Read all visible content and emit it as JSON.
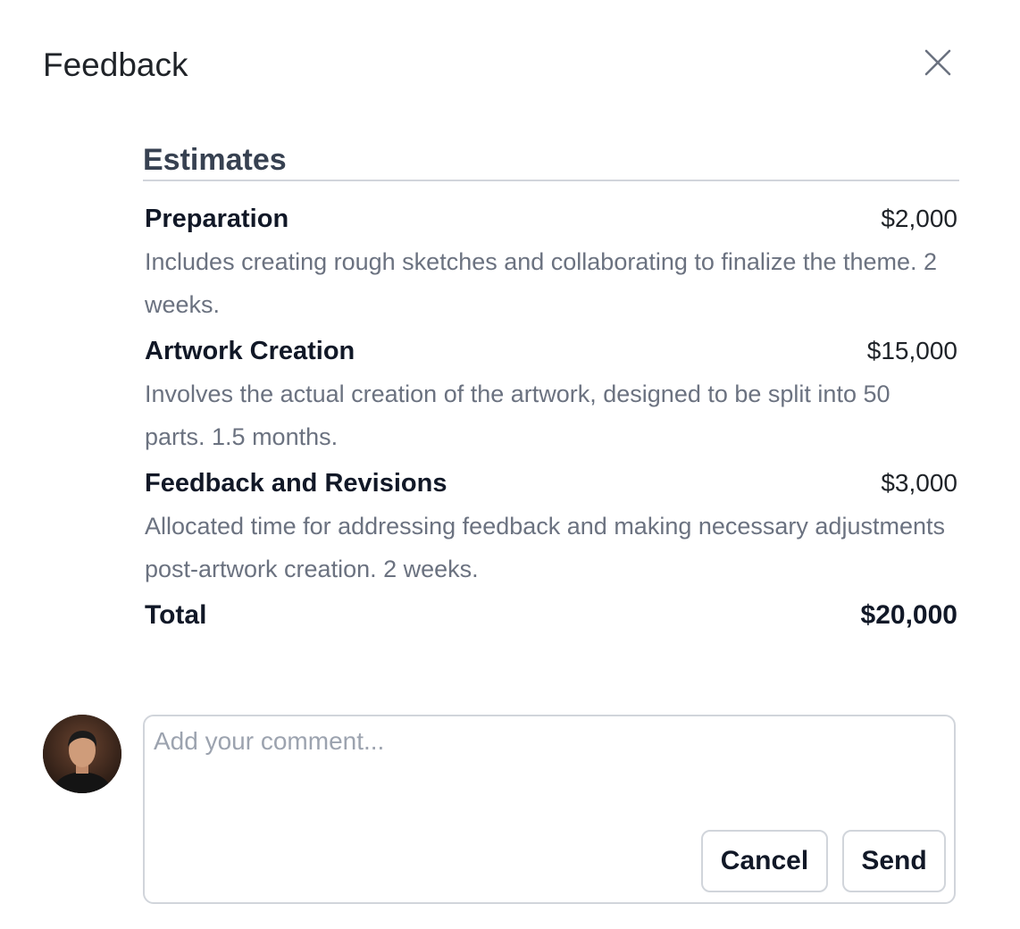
{
  "dialog": {
    "title": "Feedback",
    "close_icon": "close-icon"
  },
  "estimates": {
    "heading": "Estimates",
    "items": [
      {
        "name": "Preparation",
        "price": "$2,000",
        "description": "Includes creating rough sketches and collaborating to finalize the theme. 2 weeks."
      },
      {
        "name": "Artwork Creation",
        "price": "$15,000",
        "description": "Involves the actual creation of the artwork, designed to be split into 50 parts. 1.5 months."
      },
      {
        "name": "Feedback and Revisions",
        "price": "$3,000",
        "description": "Allocated time for addressing feedback and making necessary adjustments post-artwork creation. 2 weeks."
      }
    ],
    "total_label": "Total",
    "total_value": "$20,000"
  },
  "comment": {
    "avatar_icon": "user-avatar",
    "placeholder": "Add your comment...",
    "value": "",
    "cancel_label": "Cancel",
    "send_label": "Send"
  },
  "colors": {
    "muted_text": "#6b7280",
    "border": "#d1d5db",
    "heading": "#374151"
  }
}
